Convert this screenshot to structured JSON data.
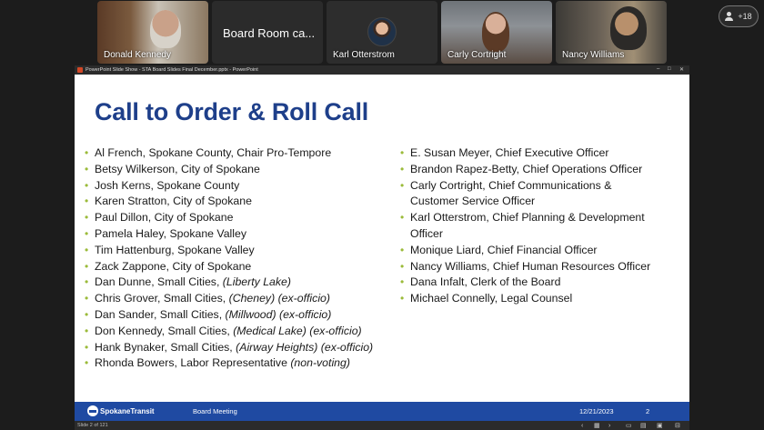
{
  "participants": [
    {
      "name": "Donald Kennedy"
    },
    {
      "name": "Board Room ca..."
    },
    {
      "name": "Karl Otterstrom"
    },
    {
      "name": "Carly Cortright"
    },
    {
      "name": "Nancy Williams"
    }
  ],
  "more_participants": "+18",
  "window": {
    "title": "PowerPoint Slide Show  -  STA Board Slides Final December.pptx - PowerPoint",
    "status": "Slide 2 of 121"
  },
  "slide": {
    "title": "Call to Order & Roll Call",
    "left_column": [
      {
        "text": "Al French, Spokane County, Chair Pro-Tempore",
        "italic": ""
      },
      {
        "text": "Betsy Wilkerson, City of Spokane",
        "italic": ""
      },
      {
        "text": "Josh Kerns, Spokane County",
        "italic": ""
      },
      {
        "text": "Karen Stratton, City of Spokane",
        "italic": ""
      },
      {
        "text": "Paul Dillon, City of Spokane",
        "italic": ""
      },
      {
        "text": "Pamela Haley, Spokane Valley",
        "italic": ""
      },
      {
        "text": "Tim Hattenburg, Spokane Valley",
        "italic": ""
      },
      {
        "text": "Zack Zappone, City of Spokane",
        "italic": ""
      },
      {
        "text": "Dan Dunne, Small Cities, ",
        "italic": "(Liberty Lake)"
      },
      {
        "text": "Chris Grover, Small Cities, ",
        "italic": "(Cheney) (ex-officio)"
      },
      {
        "text": "Dan Sander, Small Cities, ",
        "italic": "(Millwood) (ex-officio)"
      },
      {
        "text": "Don Kennedy, Small Cities, ",
        "italic": "(Medical Lake) (ex-officio)"
      },
      {
        "text": "Hank Bynaker, Small Cities, ",
        "italic": "(Airway Heights) (ex-officio)"
      },
      {
        "text": "Rhonda Bowers, Labor Representative ",
        "italic": "(non-voting)"
      }
    ],
    "right_column": [
      {
        "text": "E. Susan Meyer, Chief Executive Officer"
      },
      {
        "text": "Brandon Rapez-Betty, Chief Operations Officer"
      },
      {
        "text": "Carly Cortright, Chief Communications & Customer Service Officer"
      },
      {
        "text": "Karl Otterstrom, Chief Planning & Development Officer"
      },
      {
        "text": "Monique Liard, Chief Financial Officer"
      },
      {
        "text": "Nancy Williams, Chief Human Resources Officer"
      },
      {
        "text": "Dana Infalt, Clerk of the Board"
      },
      {
        "text": "Michael Connelly, Legal Counsel"
      }
    ],
    "footer": {
      "logo": "SpokaneTransit",
      "meeting": "Board Meeting",
      "date": "12/21/2023",
      "page": "2"
    }
  },
  "colors": {
    "title": "#1e3f8a",
    "bullet": "#9bbb3a",
    "footer_bg": "#1f4aa2"
  }
}
